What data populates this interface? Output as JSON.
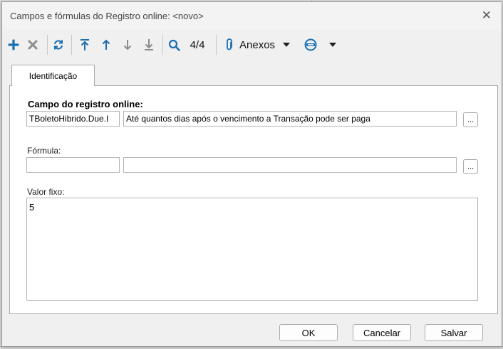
{
  "window": {
    "title": "Campos e fórmulas do Registro online: <novo>"
  },
  "toolbar": {
    "record_counter": "4/4",
    "attachments_label": "Anexos"
  },
  "tabs": [
    {
      "label": "Identificação",
      "selected": true
    }
  ],
  "form": {
    "campo": {
      "label": "Campo do registro online:",
      "code": "TBoletoHibrido.Due.I",
      "description": "Até quantos dias após o vencimento a Transação pode ser paga"
    },
    "formula": {
      "label": "Fórmula:",
      "code": "",
      "description": ""
    },
    "valor_fixo": {
      "label": "Valor fixo:",
      "value": "5"
    },
    "ellipsis": "..."
  },
  "buttons": {
    "ok": "OK",
    "cancel": "Cancelar",
    "save": "Salvar"
  },
  "colors": {
    "primary_icon": "#1a6fb3",
    "disabled_icon": "#8c8c8c",
    "attach_icon": "#1a6fb3"
  }
}
